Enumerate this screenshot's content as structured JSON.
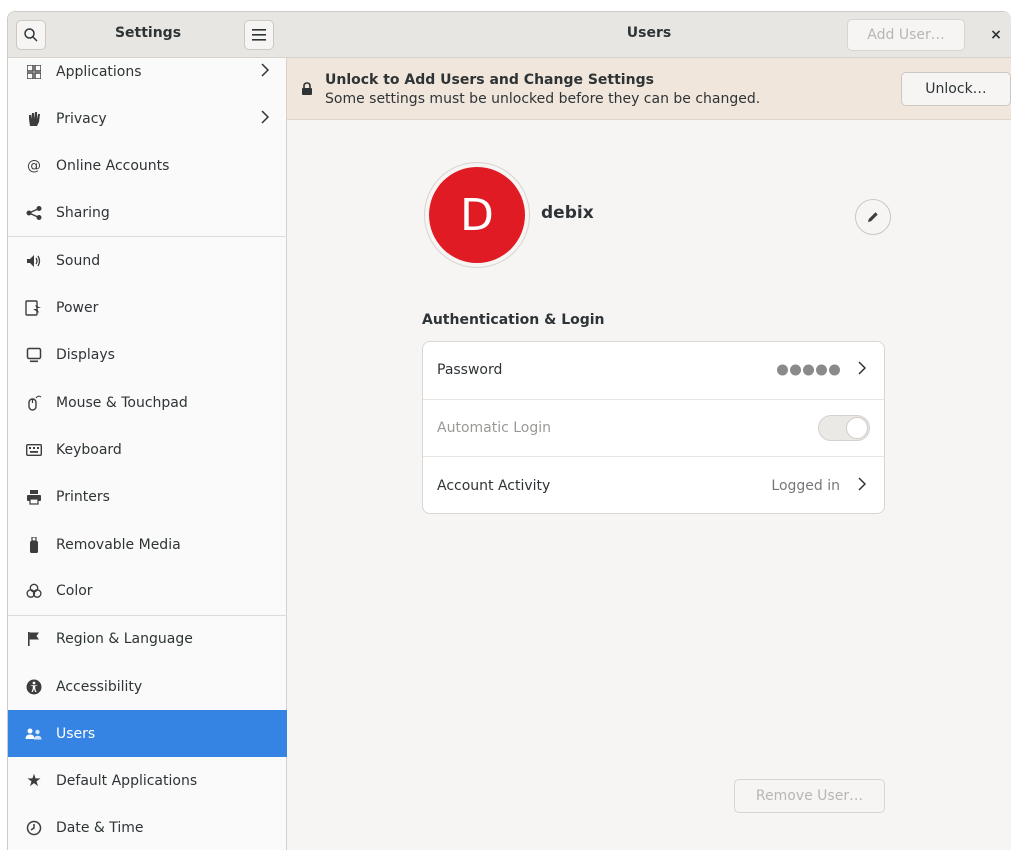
{
  "sidebar": {
    "title": "Settings",
    "items": [
      {
        "label": "Applications",
        "icon": "applications-icon",
        "glyph": "⊞",
        "chevron": true
      },
      {
        "label": "Privacy",
        "icon": "privacy-hand-icon",
        "glyph": "✋",
        "chevron": true
      },
      {
        "label": "Online Accounts",
        "icon": "at-sign-icon",
        "glyph": "@"
      },
      {
        "label": "Sharing",
        "icon": "share-icon",
        "glyph": "<"
      },
      {
        "label": "Sound",
        "icon": "speaker-icon",
        "glyph": "🔈"
      },
      {
        "label": "Power",
        "icon": "power-battery-icon",
        "glyph": "⚡"
      },
      {
        "label": "Displays",
        "icon": "display-icon",
        "glyph": "▭"
      },
      {
        "label": "Mouse & Touchpad",
        "icon": "mouse-icon",
        "glyph": "🖱"
      },
      {
        "label": "Keyboard",
        "icon": "keyboard-icon",
        "glyph": "⌨"
      },
      {
        "label": "Printers",
        "icon": "printer-icon",
        "glyph": "🖶"
      },
      {
        "label": "Removable Media",
        "icon": "usb-drive-icon",
        "glyph": "▮"
      },
      {
        "label": "Color",
        "icon": "color-icon",
        "glyph": "⚘"
      },
      {
        "label": "Region & Language",
        "icon": "flag-icon",
        "glyph": "⚑"
      },
      {
        "label": "Accessibility",
        "icon": "accessibility-icon",
        "glyph": "♿"
      },
      {
        "label": "Users",
        "icon": "users-icon",
        "glyph": "👥",
        "selected": true
      },
      {
        "label": "Default Applications",
        "icon": "star-icon",
        "glyph": "★"
      },
      {
        "label": "Date & Time",
        "icon": "clock-icon",
        "glyph": "◷"
      }
    ]
  },
  "header": {
    "title": "Users",
    "add_user_label": "Add User…",
    "close_glyph": "×"
  },
  "unlock_bar": {
    "title": "Unlock to Add Users and Change Settings",
    "subtitle": "Some settings must be unlocked before they can be changed.",
    "button_label": "Unlock…"
  },
  "user": {
    "avatar_letter": "D",
    "avatar_color": "#e01b24",
    "name": "debix"
  },
  "auth": {
    "section_title": "Authentication & Login",
    "password_label": "Password",
    "auto_login_label": "Automatic Login",
    "auto_login_enabled": false,
    "account_activity_label": "Account Activity",
    "account_activity_value": "Logged in"
  },
  "remove_user_label": "Remove User…",
  "colors": {
    "accent": "#3584e4",
    "unlock_bar_bg": "#f1e6dc"
  }
}
